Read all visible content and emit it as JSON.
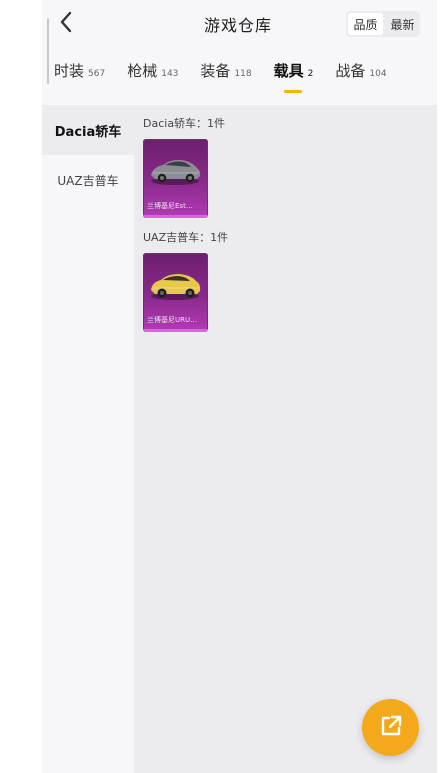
{
  "header": {
    "title": "游戏仓库",
    "sort_options": [
      {
        "label": "品质",
        "active": true
      },
      {
        "label": "最新",
        "active": false
      }
    ]
  },
  "tabs": [
    {
      "label": "时装",
      "count": "567",
      "active": false
    },
    {
      "label": "枪械",
      "count": "143",
      "active": false
    },
    {
      "label": "装备",
      "count": "118",
      "active": false
    },
    {
      "label": "载具",
      "count": "2",
      "active": true
    },
    {
      "label": "战备",
      "count": "104",
      "active": false
    }
  ],
  "sidebar": {
    "items": [
      {
        "label": "Dacia轿车",
        "active": true
      },
      {
        "label": "UAZ吉普车",
        "active": false
      }
    ]
  },
  "groups": [
    {
      "title": "Dacia轿车：1件",
      "items": [
        {
          "name": "兰博基尼Est…",
          "car_color": "#8a8d92"
        }
      ]
    },
    {
      "title": "UAZ吉普车：1件",
      "items": [
        {
          "name": "兰博基尼URU…",
          "car_color": "#e8c84a"
        }
      ]
    }
  ],
  "colors": {
    "accent": "#f4b400",
    "fab": "#f4a91d",
    "card_purple": "#8a2a8c"
  },
  "icons": {
    "back": "chevron-left-icon",
    "fab": "external-link-icon"
  }
}
